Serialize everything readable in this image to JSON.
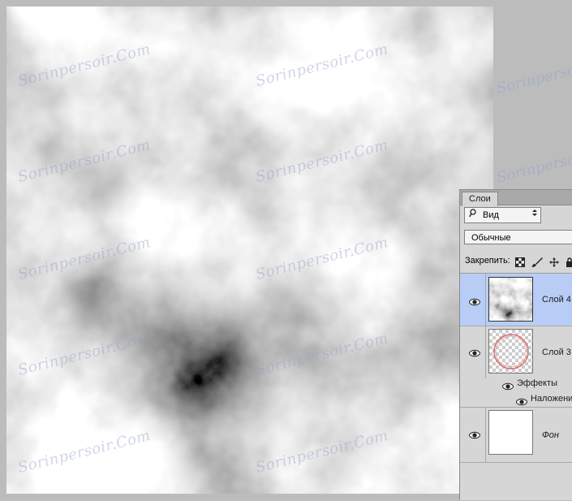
{
  "watermark": "Sorinpersoir.Com",
  "layers_panel": {
    "tab_label": "Слои",
    "filter_label": "Вид",
    "blend_mode": "Обычные",
    "lock_label": "Закрепить:",
    "layers": [
      {
        "name": "Слой 4",
        "selected": true
      },
      {
        "name": "Слой 3",
        "effects_label": "Эффекты",
        "effect_name": "Наложение"
      },
      {
        "name": "Фон"
      }
    ]
  },
  "colors": {
    "selected_row": "#b7cdf6",
    "panel_bg": "#d6d6d6",
    "canvas_bg": "#bcbcbc"
  },
  "icons": [
    "search-icon",
    "dropdown-arrow-icon",
    "lock-transparent-icon",
    "lock-brush-icon",
    "lock-move-icon",
    "lock-all-icon",
    "eye-icon"
  ]
}
